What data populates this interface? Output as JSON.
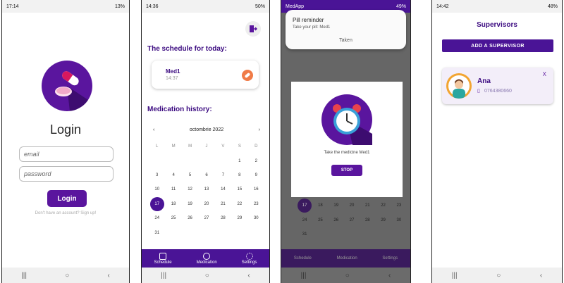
{
  "screen1": {
    "status_time": "17:14",
    "status_battery": "13%",
    "title": "Login",
    "email_placeholder": "email",
    "password_placeholder": "password",
    "login_button": "Login",
    "signup_text": "Don't have an account? Sign up!"
  },
  "screen2": {
    "status_time": "14:36",
    "status_battery": "50%",
    "schedule_title": "The schedule for today:",
    "med_name": "Med1",
    "med_time": "14:37",
    "history_title": "Medication history:",
    "calendar": {
      "month": "octombrie 2022",
      "dow": [
        "L",
        "M",
        "M",
        "J",
        "V",
        "S",
        "D"
      ],
      "rows": [
        [
          "",
          "",
          "",
          "",
          "",
          "1",
          "2"
        ],
        [
          "3",
          "4",
          "5",
          "6",
          "7",
          "8",
          "9"
        ],
        [
          "10",
          "11",
          "12",
          "13",
          "14",
          "15",
          "16"
        ],
        [
          "17",
          "18",
          "19",
          "20",
          "21",
          "22",
          "23"
        ],
        [
          "24",
          "25",
          "26",
          "27",
          "28",
          "29",
          "30"
        ],
        [
          "31",
          "",
          "",
          "",
          "",
          "",
          ""
        ]
      ],
      "selected": "17"
    },
    "nav": [
      "Schedule",
      "Medication",
      "Settings"
    ]
  },
  "screen3": {
    "status_app": "MedApp",
    "status_battery": "49%",
    "notif_title": "Pill reminder",
    "notif_text": "Take your pill: Med1",
    "notif_action": "Taken",
    "dialog_text": "Take the medicine Med1",
    "stop_button": "STOP",
    "bg_rows": [
      [
        "17",
        "18",
        "19",
        "20",
        "21",
        "22",
        "23"
      ],
      [
        "24",
        "25",
        "26",
        "27",
        "28",
        "29",
        "30"
      ],
      [
        "31",
        "",
        "",
        "",
        "",
        "",
        ""
      ]
    ],
    "nav": [
      "Schedule",
      "Medication",
      "Settings"
    ]
  },
  "screen4": {
    "status_time": "14:42",
    "status_battery": "48%",
    "title": "Supervisors",
    "add_button": "ADD A SUPERVISOR",
    "supervisor_name": "Ana",
    "supervisor_phone": "0764380660",
    "remove_label": "X"
  },
  "colors": {
    "primary": "#4a1496",
    "accent": "#f07b47"
  }
}
